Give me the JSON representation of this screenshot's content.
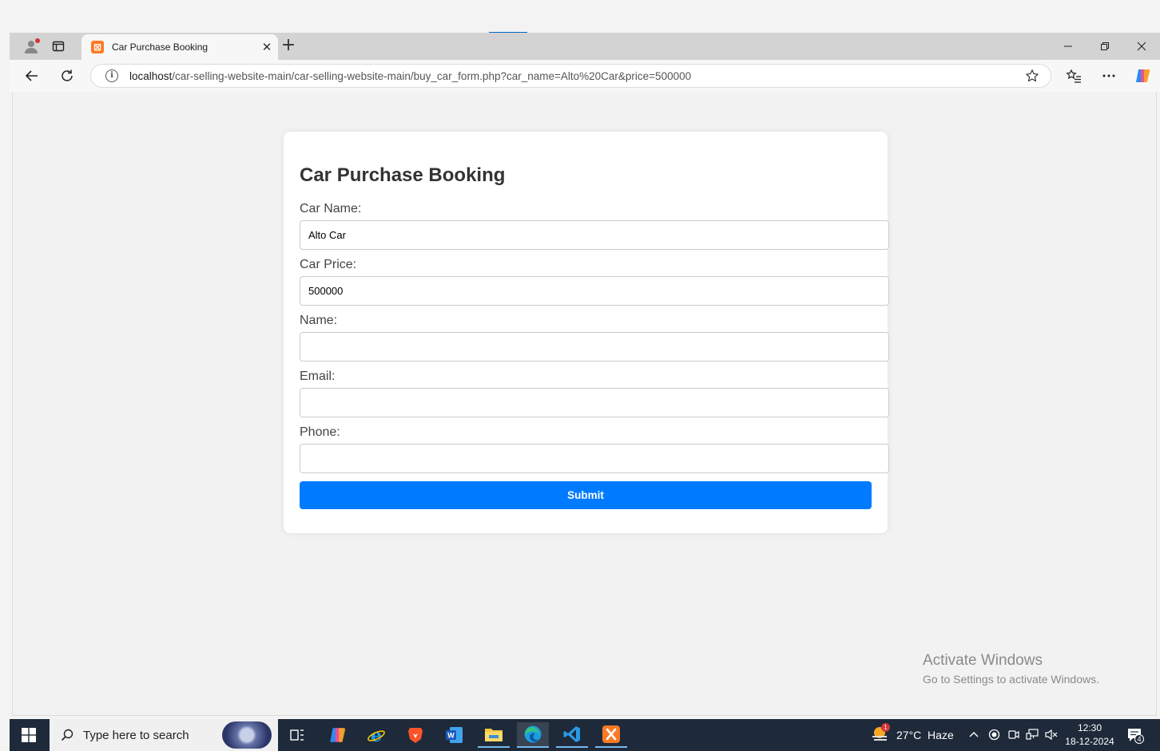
{
  "browser": {
    "tab_title": "Car Purchase Booking",
    "url_host": "localhost",
    "url_path": "/car-selling-website-main/car-selling-website-main/buy_car_form.php?car_name=Alto%20Car&price=500000"
  },
  "form": {
    "title": "Car Purchase Booking",
    "car_name_label": "Car Name:",
    "car_name_value": "Alto Car",
    "car_price_label": "Car Price:",
    "car_price_value": "500000",
    "name_label": "Name:",
    "name_value": "",
    "email_label": "Email:",
    "email_value": "",
    "phone_label": "Phone:",
    "phone_value": "",
    "submit_label": "Submit"
  },
  "watermark": {
    "line1": "Activate Windows",
    "line2": "Go to Settings to activate Windows."
  },
  "taskbar": {
    "search_placeholder": "Type here to search",
    "weather": "27°C  Haze",
    "weather_badge": "1",
    "time": "12:30",
    "date": "18-12-2024",
    "notification_count": "4"
  },
  "colors": {
    "accent": "#007bff",
    "taskbar": "#1e2a3a",
    "page_bg": "#f2f2f2"
  }
}
